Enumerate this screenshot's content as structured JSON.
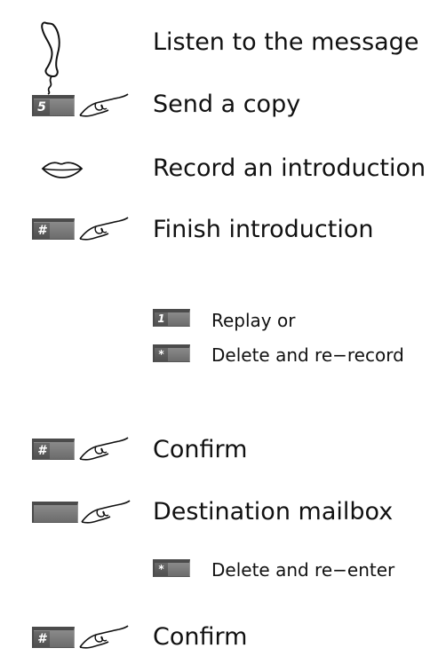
{
  "steps": [
    {
      "text": "Listen to the message",
      "icon": "handset-icon"
    },
    {
      "text": "Send a copy",
      "key": "5",
      "icon": "finger-press-icon"
    },
    {
      "text": "Record an introduction",
      "icon": "lips-speak-icon"
    },
    {
      "text": "Finish introduction",
      "key": "#",
      "icon": "finger-press-icon"
    },
    {
      "text": "Replay or",
      "key": "1"
    },
    {
      "text": "Delete and re−record",
      "key": "*"
    },
    {
      "text": "Confirm",
      "key": "#",
      "icon": "finger-press-icon"
    },
    {
      "text": "Destination mailbox",
      "key": "",
      "icon": "finger-press-icon"
    },
    {
      "text": "Delete and re−enter",
      "key": "*"
    },
    {
      "text": "Confirm",
      "key": "#",
      "icon": "finger-press-icon"
    }
  ],
  "colors": {
    "key_face": "#7a7a7a",
    "key_shadow": "#4b4b4b",
    "text": "#111111"
  }
}
